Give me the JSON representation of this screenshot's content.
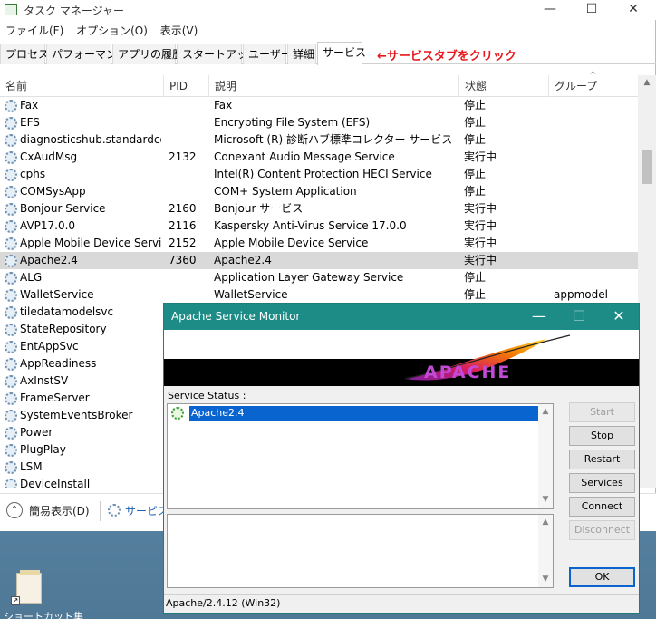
{
  "task_manager": {
    "title": "タスク マネージャー",
    "menu": [
      "ファイル(F)",
      "オプション(O)",
      "表示(V)"
    ],
    "tabs": [
      "プロセス",
      "パフォーマンス",
      "アプリの履歴",
      "スタートアップ",
      "ユーザー",
      "詳細",
      "サービス"
    ],
    "active_tab": "サービス",
    "annotation": "←サービスタブをクリック",
    "columns": [
      "名前",
      "PID",
      "説明",
      "状態",
      "グループ"
    ],
    "rows": [
      {
        "name": "Fax",
        "pid": "",
        "desc": "Fax",
        "status": "停止",
        "group": ""
      },
      {
        "name": "EFS",
        "pid": "",
        "desc": "Encrypting File System (EFS)",
        "status": "停止",
        "group": ""
      },
      {
        "name": "diagnosticshub.standardco...",
        "pid": "",
        "desc": "Microsoft (R) 診断ハブ標準コレクター サービス",
        "status": "停止",
        "group": ""
      },
      {
        "name": "CxAudMsg",
        "pid": "2132",
        "desc": "Conexant Audio Message Service",
        "status": "実行中",
        "group": ""
      },
      {
        "name": "cphs",
        "pid": "",
        "desc": "Intel(R) Content Protection HECI Service",
        "status": "停止",
        "group": ""
      },
      {
        "name": "COMSysApp",
        "pid": "",
        "desc": "COM+ System Application",
        "status": "停止",
        "group": ""
      },
      {
        "name": "Bonjour Service",
        "pid": "2160",
        "desc": "Bonjour サービス",
        "status": "実行中",
        "group": ""
      },
      {
        "name": "AVP17.0.0",
        "pid": "2116",
        "desc": "Kaspersky Anti-Virus Service 17.0.0",
        "status": "実行中",
        "group": ""
      },
      {
        "name": "Apple Mobile Device Service",
        "pid": "2152",
        "desc": "Apple Mobile Device Service",
        "status": "実行中",
        "group": ""
      },
      {
        "name": "Apache2.4",
        "pid": "7360",
        "desc": "Apache2.4",
        "status": "実行中",
        "group": ""
      },
      {
        "name": "ALG",
        "pid": "",
        "desc": "Application Layer Gateway Service",
        "status": "停止",
        "group": ""
      },
      {
        "name": "WalletService",
        "pid": "",
        "desc": "WalletService",
        "status": "停止",
        "group": "appmodel"
      },
      {
        "name": "tiledatamodelsvc",
        "pid": "",
        "desc": "",
        "status": "",
        "group": ""
      },
      {
        "name": "StateRepository",
        "pid": "",
        "desc": "",
        "status": "",
        "group": ""
      },
      {
        "name": "EntAppSvc",
        "pid": "",
        "desc": "",
        "status": "",
        "group": ""
      },
      {
        "name": "AppReadiness",
        "pid": "",
        "desc": "",
        "status": "",
        "group": ""
      },
      {
        "name": "AxInstSV",
        "pid": "",
        "desc": "",
        "status": "",
        "group": ""
      },
      {
        "name": "FrameServer",
        "pid": "",
        "desc": "",
        "status": "",
        "group": ""
      },
      {
        "name": "SystemEventsBroker",
        "pid": "",
        "desc": "",
        "status": "",
        "group": ""
      },
      {
        "name": "Power",
        "pid": "",
        "desc": "",
        "status": "",
        "group": ""
      },
      {
        "name": "PlugPlay",
        "pid": "",
        "desc": "",
        "status": "",
        "group": ""
      },
      {
        "name": "LSM",
        "pid": "",
        "desc": "",
        "status": "",
        "group": ""
      },
      {
        "name": "DeviceInstall",
        "pid": "",
        "desc": "",
        "status": "",
        "group": ""
      }
    ],
    "footer_fewer": "簡易表示(D)",
    "footer_link": "サービス管"
  },
  "apache_monitor": {
    "title": "Apache Service Monitor",
    "logo_text": "APACHE",
    "status_label": "Service Status :",
    "service_item": "Apache2.4",
    "buttons": [
      "Start",
      "Stop",
      "Restart",
      "Services",
      "Connect",
      "Disconnect"
    ],
    "ok_button": "OK",
    "status_bar": "Apache/2.4.12 (Win32)"
  },
  "desktop": {
    "icon_label": "ショートカット集"
  },
  "colors": {
    "annotation": "#e8171c",
    "monitor_titlebar": "#1e8c86",
    "selection": "#0a64d0"
  }
}
